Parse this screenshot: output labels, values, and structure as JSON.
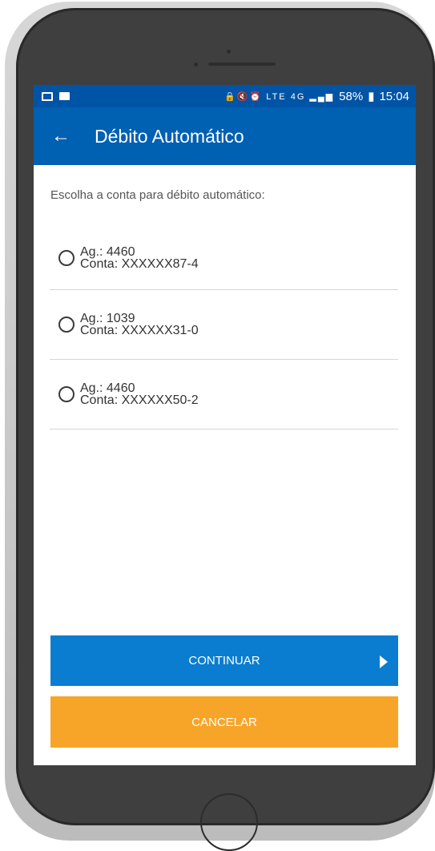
{
  "status_bar": {
    "battery": "58%",
    "time": "15:04",
    "icons": [
      "image-icon",
      "message-icon",
      "lock-icon",
      "mute-icon",
      "alarm-icon",
      "volte-icon",
      "4g-icon",
      "signal-icon",
      "battery-icon"
    ]
  },
  "app_bar": {
    "title": "Débito Automático",
    "back_icon": "arrow-left-icon"
  },
  "prompt": "Escolha a conta para débito automático:",
  "accounts": [
    {
      "agency": "Ag.: 4460",
      "account": "Conta: XXXXXX87-4",
      "selected": false
    },
    {
      "agency": "Ag.: 1039",
      "account": "Conta: XXXXXX31-0",
      "selected": false
    },
    {
      "agency": "Ag.: 4460",
      "account": "Conta: XXXXXX50-2",
      "selected": false
    }
  ],
  "buttons": {
    "continue_label": "CONTINUAR",
    "cancel_label": "CANCELAR"
  },
  "colors": {
    "status_bar": "#0054a6",
    "app_bar": "#0060b2",
    "continue": "#0a7dd0",
    "cancel": "#f7a529"
  }
}
